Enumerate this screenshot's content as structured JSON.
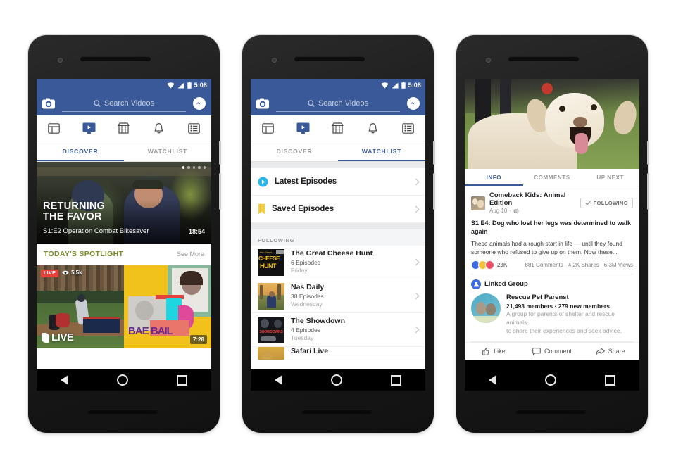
{
  "statusbar": {
    "time": "5:08",
    "icons": [
      "wifi-icon",
      "signal-icon",
      "battery-icon"
    ]
  },
  "fb_header": {
    "camera_icon": "camera-icon",
    "search_placeholder": "Search Videos",
    "search_icon": "search-icon",
    "messenger_icon": "messenger-icon"
  },
  "nav_tabs": [
    {
      "name": "news-feed",
      "icon": "news-feed-icon",
      "active": false
    },
    {
      "name": "video",
      "icon": "video-play-icon",
      "active": true
    },
    {
      "name": "marketplace",
      "icon": "store-icon",
      "active": false
    },
    {
      "name": "notifications",
      "icon": "bell-icon",
      "active": false
    },
    {
      "name": "menu",
      "icon": "list-menu-icon",
      "active": false
    }
  ],
  "sub_tabs": {
    "discover": "DISCOVER",
    "watchlist": "WATCHLIST"
  },
  "android_nav": {
    "back": "back-triangle-icon",
    "home": "home-circle-icon",
    "recents": "recents-square-icon"
  },
  "phone1": {
    "active_subtab": "DISCOVER",
    "hero": {
      "title_line1": "RETURNING",
      "title_line2": "THE FAVOR",
      "subtitle": "S1:E2 Operation Combat Bikesaver",
      "duration": "18:54",
      "pagination_dots": 5,
      "active_dot": 0
    },
    "spotlight": {
      "title": "TODAY'S SPOTLIGHT",
      "see_more": "See More"
    },
    "thumbnails": [
      {
        "live_label": "LIVE",
        "views": "5.5k",
        "views_icon": "eye-icon",
        "brand": "LIVE",
        "logo": "mlb-logo"
      },
      {
        "brand": "BAE  BAIL",
        "duration": "7:28"
      }
    ]
  },
  "phone2": {
    "active_subtab": "WATCHLIST",
    "quick_rows": [
      {
        "label": "Latest Episodes",
        "icon": "play-circle-icon"
      },
      {
        "label": "Saved Episodes",
        "icon": "bookmark-icon"
      }
    ],
    "following_header": "FOLLOWING",
    "shows": [
      {
        "name": "The Great Cheese Hunt",
        "episodes": "6 Episodes",
        "day": "Friday",
        "thumb": "cheese-hunt-thumb"
      },
      {
        "name": "Nas Daily",
        "episodes": "38 Episodes",
        "day": "Wednesday",
        "thumb": "nas-daily-thumb"
      },
      {
        "name": "The Showdown",
        "episodes": "4 Episodes",
        "day": "Tuesday",
        "thumb": "showdown-thumb"
      },
      {
        "name": "Safari Live",
        "episodes": "",
        "day": "",
        "thumb": "safari-live-thumb"
      }
    ]
  },
  "phone3": {
    "video": {
      "thumbnail": "golden-retriever-dog-video"
    },
    "tabs": [
      {
        "label": "INFO",
        "active": true
      },
      {
        "label": "COMMENTS",
        "active": false
      },
      {
        "label": "UP NEXT",
        "active": false
      }
    ],
    "post": {
      "page_name": "Comeback Kids: Animal Edition",
      "date": "Aug 10",
      "separator": "·",
      "privacy_icon": "globe-icon",
      "follow_button": "FOLLOWING",
      "follow_check_icon": "check-icon",
      "title": "S1 E4: Dog who lost her legs was determined to walk again",
      "body": "These animals had a rough start in life — until they found someone who refused to give up on them. Now these...",
      "reactions": {
        "count": "23K",
        "types": [
          "like-reaction",
          "wow-reaction",
          "love-reaction"
        ]
      },
      "comments": "881 Comments",
      "shares": "4.2K Shares",
      "views": "6.3M Views"
    },
    "linked_group": {
      "heading": "Linked Group",
      "heading_icon": "group-icon",
      "name": "Rescue Pet Parenst",
      "members": "21,493 members · 279 new members",
      "description_line1": "A group for parents of shelter and rescue animals",
      "description_line2": "to share their experiences and seek advice."
    },
    "actions": [
      {
        "label": "Like",
        "icon": "thumbs-up-icon"
      },
      {
        "label": "Comment",
        "icon": "comment-bubble-icon"
      },
      {
        "label": "Share",
        "icon": "share-arrow-icon"
      }
    ]
  },
  "colors": {
    "fb_blue": "#3a5998",
    "live_red": "#e8403a",
    "spotlight_green": "#7a8b28"
  }
}
